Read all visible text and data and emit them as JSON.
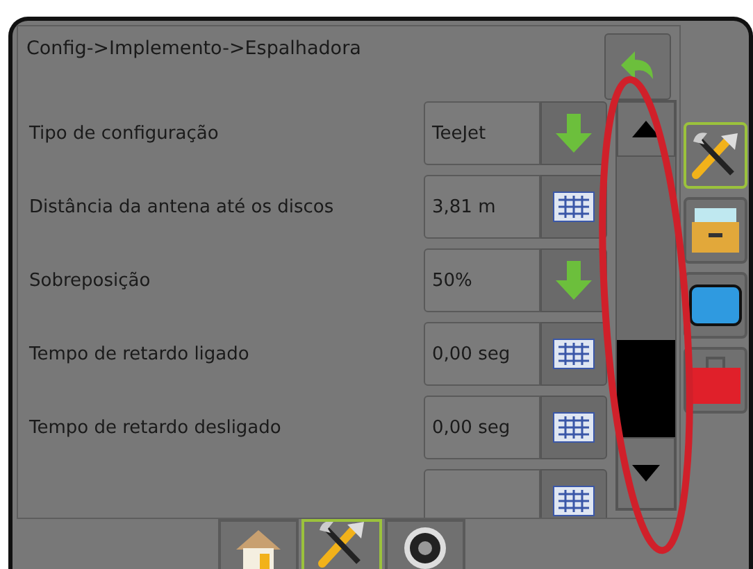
{
  "breadcrumb": "Config->Implemento->Espalhadora",
  "settings": [
    {
      "label": "Tipo de configuração",
      "value": "TeeJet",
      "kind": "dropdown"
    },
    {
      "label": "Distância da antena até os discos",
      "value": "3,81 m",
      "kind": "keypad"
    },
    {
      "label": "Sobreposição",
      "value": "50%",
      "kind": "dropdown"
    },
    {
      "label": "Tempo de retardo ligado",
      "value": "0,00 seg",
      "kind": "keypad"
    },
    {
      "label": "Tempo de retardo desligado",
      "value": "0,00 seg",
      "kind": "keypad"
    },
    {
      "kind": "keypad"
    }
  ],
  "side_tabs": [
    {
      "kind": "tools",
      "selected": true
    },
    {
      "kind": "drawer",
      "selected": false
    },
    {
      "kind": "screen",
      "selected": false
    },
    {
      "kind": "toolbox",
      "selected": false
    }
  ],
  "bottom_tabs": [
    {
      "kind": "home",
      "selected": false
    },
    {
      "kind": "tools",
      "selected": true
    },
    {
      "kind": "gauge",
      "selected": false
    }
  ],
  "annotation": {
    "kind": "ellipse"
  }
}
